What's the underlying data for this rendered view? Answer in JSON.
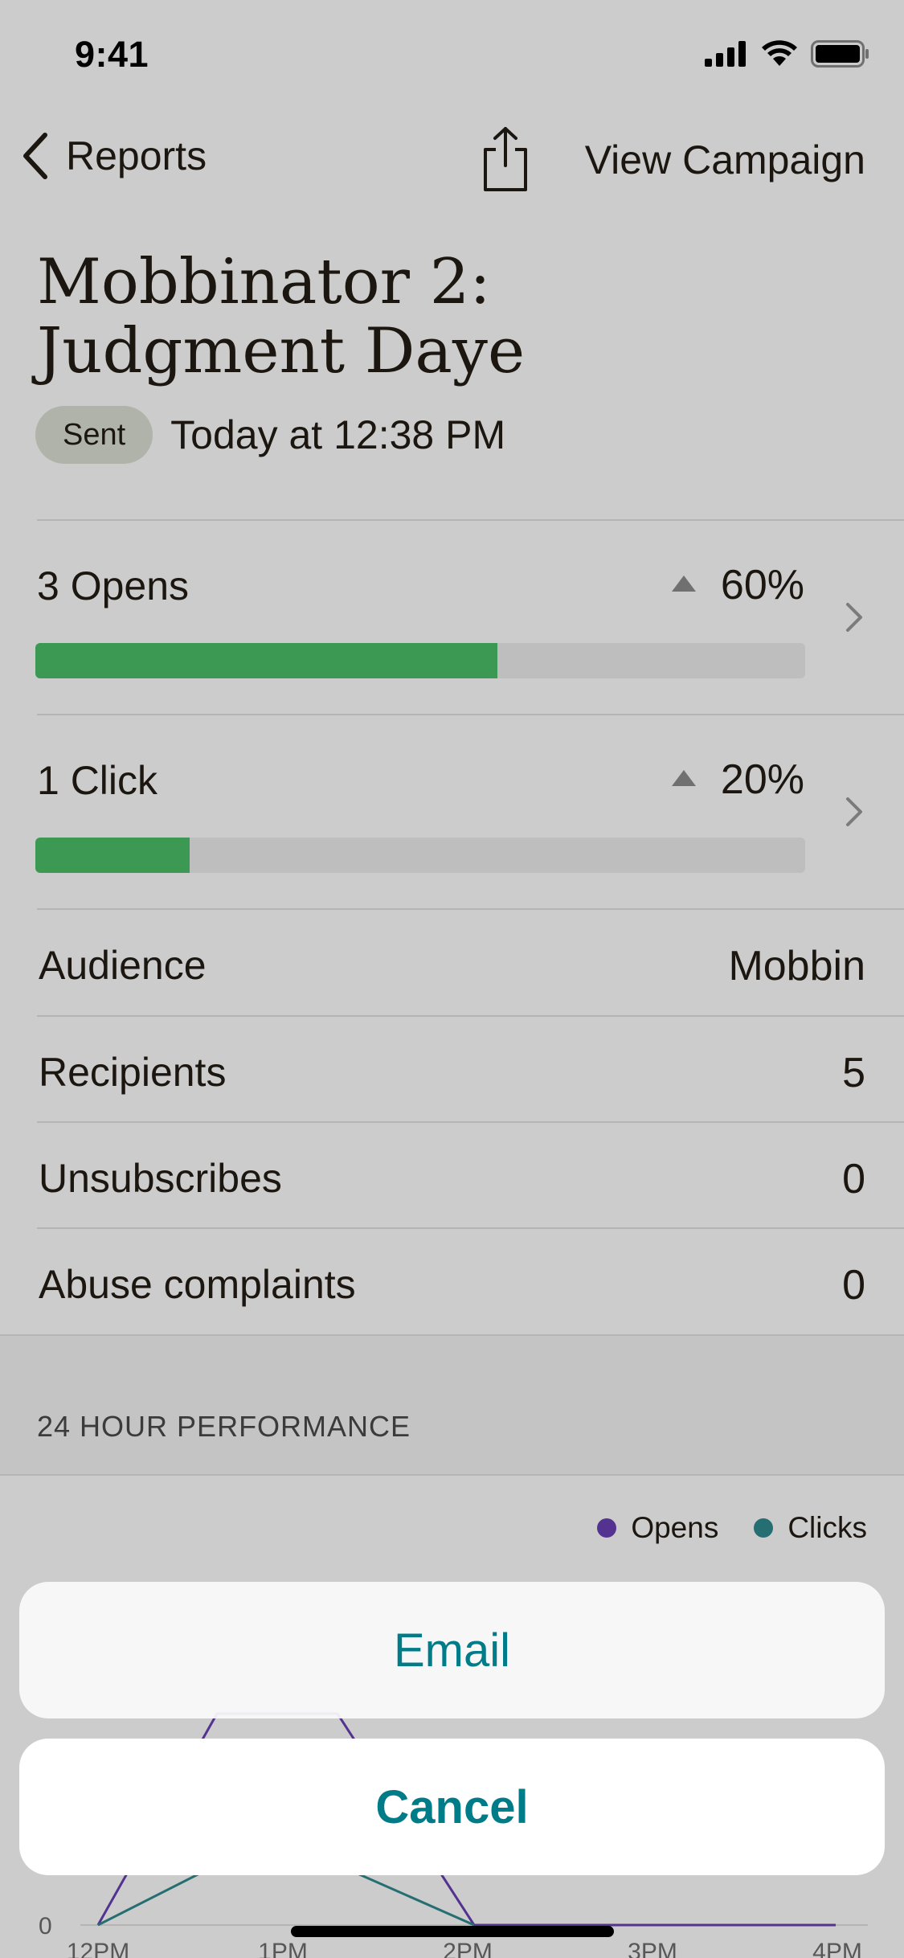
{
  "status_bar": {
    "time": "9:41",
    "icons": [
      "cellular-signal-icon",
      "wifi-icon",
      "battery-icon"
    ]
  },
  "nav": {
    "back_label": "Reports",
    "share_icon": "share-icon",
    "view_campaign": "View Campaign"
  },
  "campaign": {
    "title_line1": "Mobbinator 2:",
    "title_line2": "Judgment Daye",
    "status_badge": "Sent",
    "sent_time": "Today at 12:38 PM"
  },
  "metrics": [
    {
      "label": "3 Opens",
      "percent_text": "60%",
      "progress": 0.6
    },
    {
      "label": "1 Click",
      "percent_text": "20%",
      "progress": 0.2
    }
  ],
  "details": [
    {
      "label": "Audience",
      "value": "Mobbin"
    },
    {
      "label": "Recipients",
      "value": "5"
    },
    {
      "label": "Unsubscribes",
      "value": "0"
    },
    {
      "label": "Abuse complaints",
      "value": "0"
    }
  ],
  "performance": {
    "title": "24 HOUR PERFORMANCE",
    "legend": [
      {
        "label": "Opens",
        "color": "#6a3fb5"
      },
      {
        "label": "Clicks",
        "color": "#2f8a8f"
      }
    ],
    "y_zero_label": "0",
    "x_labels": [
      "12PM",
      "1PM",
      "2PM",
      "3PM",
      "4PM"
    ]
  },
  "action_sheet": {
    "email_label": "Email",
    "cancel_label": "Cancel"
  },
  "colors": {
    "accent": "#007c89",
    "progress_fill": "#4cc06a",
    "progress_track": "#eeeeee",
    "badge_bg": "#dce0d4"
  }
}
